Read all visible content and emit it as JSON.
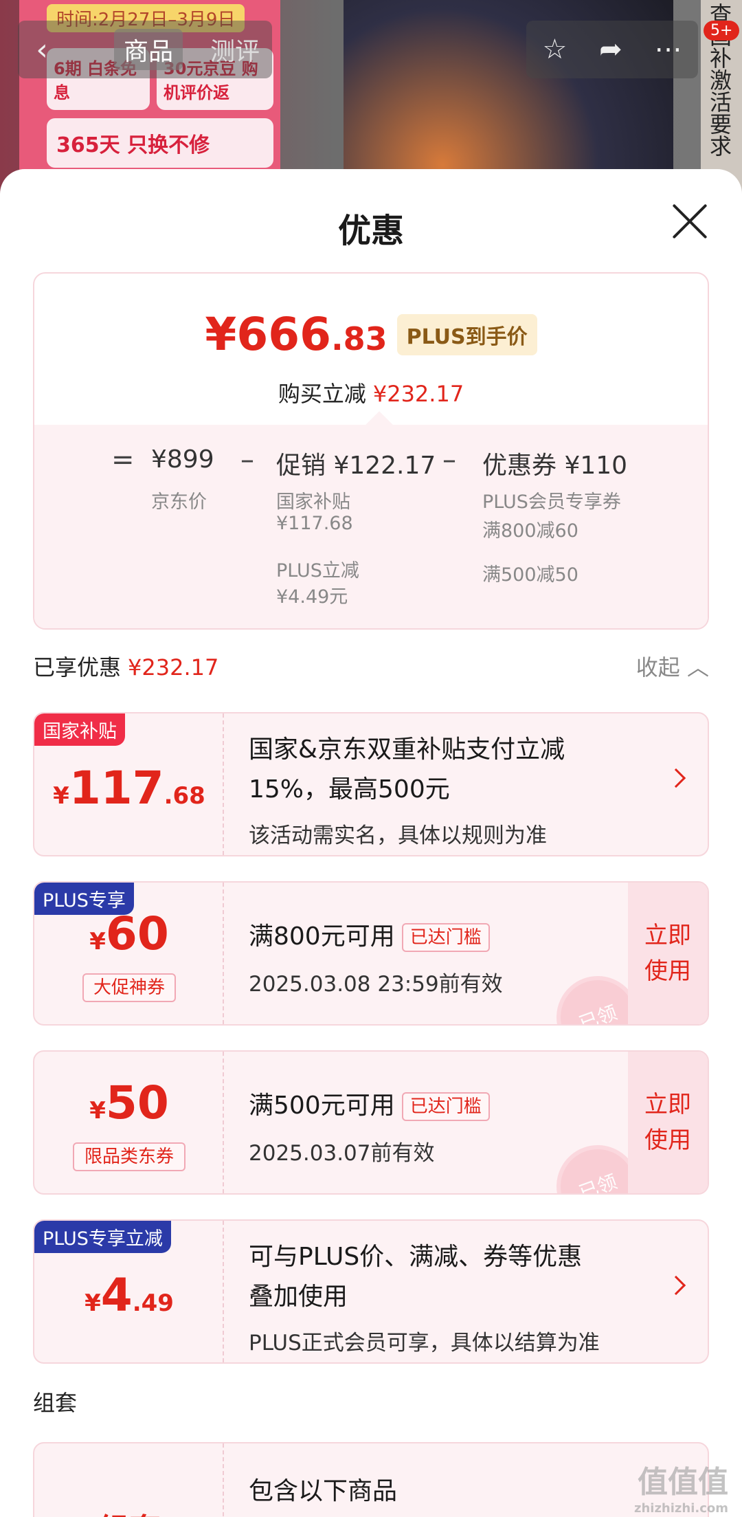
{
  "bg": {
    "promo_time": "时间:2月27日–3月9日",
    "promo_a": "6期 白条免息",
    "promo_b": "30元京豆 购机评价返",
    "promo_c": "365天 只换不修",
    "side_text": "查国补激活要求",
    "nav_tabs": [
      "商品",
      "测评"
    ],
    "badge": "5+"
  },
  "sheet": {
    "title": "优惠"
  },
  "price": {
    "final_int": "¥666",
    "final_dec": ".83",
    "plus_tag": "PLUS到手价",
    "sub_label": "购买立减",
    "sub_value": "¥232.17",
    "eq": "=",
    "jd_price": "¥899",
    "jd_label": "京东价",
    "minus1": "–",
    "promo_title": "促销 ¥122.17",
    "promo_note1": "国家补贴",
    "promo_note1_val": "¥117.68",
    "promo_note2": "PLUS立减",
    "promo_note2_val": "¥4.49元",
    "minus2": "–",
    "coupon_title": "优惠券 ¥110",
    "coupon_note1": "PLUS会员专享券",
    "coupon_note2": "满800减60",
    "coupon_note3": "满500减50"
  },
  "enjoyed": {
    "label": "已享优惠",
    "value": "¥232.17",
    "collapse": "收起"
  },
  "coupons": [
    {
      "tag": "国家补贴",
      "cur": "¥",
      "big": "117",
      "dec": ".68",
      "title1": "国家&京东双重补贴支付立减",
      "title2": "15%，最高500元",
      "desc": "该活动需实名，具体以规则为准"
    },
    {
      "tag": "PLUS专享",
      "cur": "¥",
      "big": "60",
      "subtag": "大促神券",
      "title": "满800元可用",
      "reach": "已达门槛",
      "desc": "2025.03.08 23:59前有效",
      "use1": "立即",
      "use2": "使用",
      "stamp": "已领"
    },
    {
      "cur": "¥",
      "big": "50",
      "subtag": "限品类东券",
      "title": "满500元可用",
      "reach": "已达门槛",
      "desc": "2025.03.07前有效",
      "use1": "立即",
      "use2": "使用",
      "stamp": "已领"
    },
    {
      "tag": "PLUS专享立减",
      "cur": "¥",
      "big": "4",
      "dec": ".49",
      "title1": "可与PLUS价、满减、券等优惠",
      "title2": "叠加使用",
      "desc": "PLUS正式会员可享，具体以结算为准"
    }
  ],
  "combo": {
    "label": "组套",
    "name": "组套",
    "title": "包含以下商品"
  },
  "watermark": {
    "main": "值值值",
    "sub": "zhizhizhi.com"
  },
  "colors": {
    "accent": "#e1251b",
    "plus_blue": "#2b3aa8",
    "card_bg": "#fdf2f4"
  }
}
